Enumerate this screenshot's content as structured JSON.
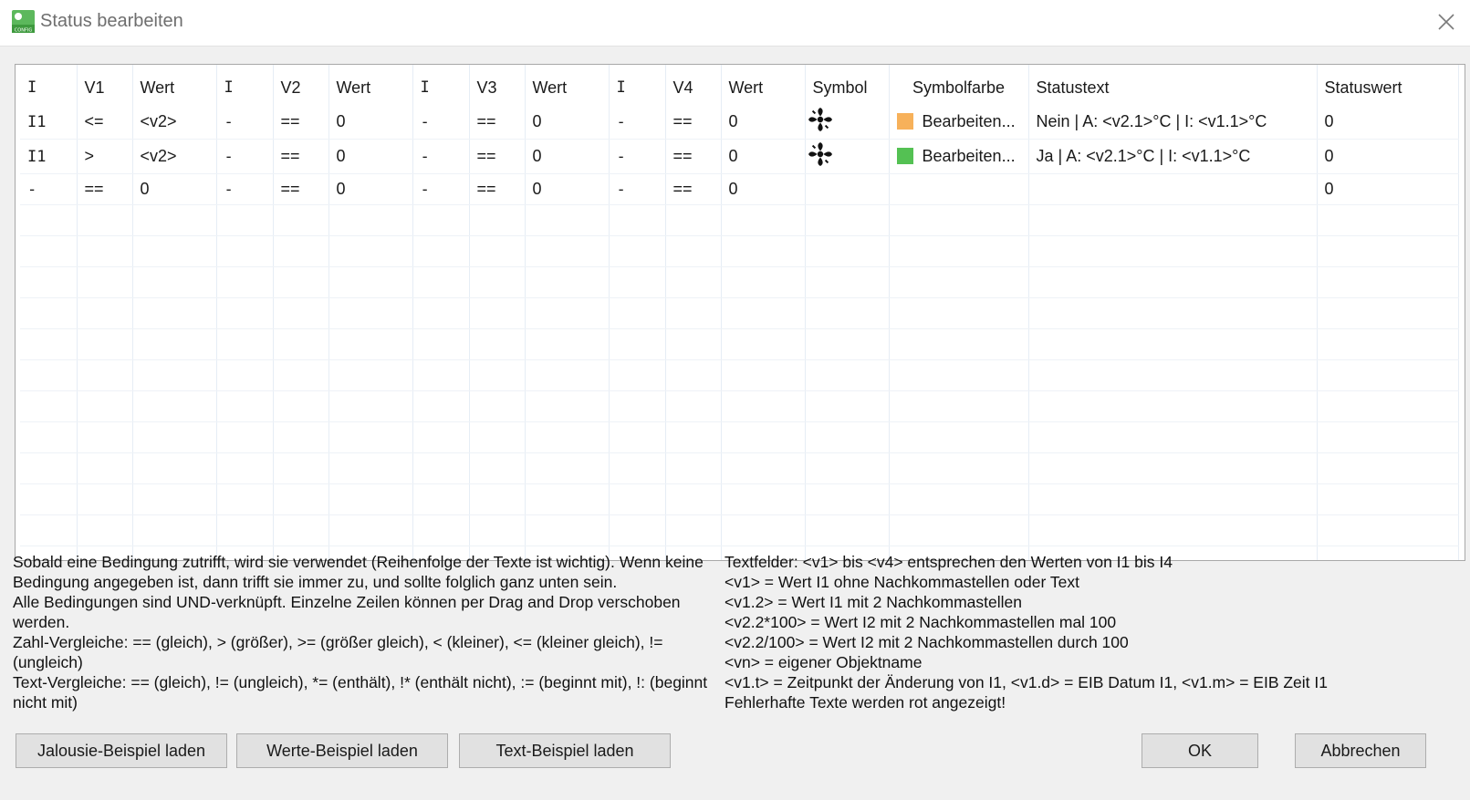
{
  "window": {
    "title": "Status bearbeiten"
  },
  "colors": {
    "orange": "#f7b15a",
    "green": "#54c153",
    "accent": "#4caf50"
  },
  "table": {
    "headers": [
      "I",
      "V1",
      "Wert",
      "I",
      "V2",
      "Wert",
      "I",
      "V3",
      "Wert",
      "I",
      "V4",
      "Wert",
      "Symbol",
      "Symbolfarbe",
      "Statustext",
      "Statuswert"
    ],
    "rows": [
      {
        "i1": "I1",
        "v1": "<=",
        "w1": "<v2>",
        "i2": "-",
        "v2": "==",
        "w2": "0",
        "i3": "-",
        "v3": "==",
        "w3": "0",
        "i4": "-",
        "v4": "==",
        "w4": "0",
        "symbol": "fan-icon",
        "color_label": "Bearbeiten...",
        "color_hex": "#f7b15a",
        "statustext": "Nein | A: <v2.1>°C | I: <v1.1>°C",
        "statuswert": "0"
      },
      {
        "i1": "I1",
        "v1": ">",
        "w1": "<v2>",
        "i2": "-",
        "v2": "==",
        "w2": "0",
        "i3": "-",
        "v3": "==",
        "w3": "0",
        "i4": "-",
        "v4": "==",
        "w4": "0",
        "symbol": "fan-icon",
        "color_label": "Bearbeiten...",
        "color_hex": "#54c153",
        "statustext": "Ja | A: <v2.1>°C | I: <v1.1>°C",
        "statuswert": "0"
      },
      {
        "i1": "-",
        "v1": "==",
        "w1": "0",
        "i2": "-",
        "v2": "==",
        "w2": "0",
        "i3": "-",
        "v3": "==",
        "w3": "0",
        "i4": "-",
        "v4": "==",
        "w4": "0",
        "symbol": "",
        "color_label": "",
        "color_hex": "",
        "statustext": "",
        "statuswert": "0"
      }
    ]
  },
  "help_left": [
    "Sobald eine Bedingung zutrifft, wird sie verwendet (Reihenfolge der Texte ist wichtig). Wenn keine Bedingung angegeben ist, dann trifft sie immer zu, und sollte folglich ganz unten sein.",
    "Alle Bedingungen sind UND-verknüpft. Einzelne Zeilen können per Drag and Drop verschoben werden.",
    "Zahl-Vergleiche: == (gleich), > (größer), >= (größer gleich), < (kleiner), <= (kleiner gleich), != (ungleich)",
    "Text-Vergleiche: == (gleich), != (ungleich), *= (enthält), !* (enthält nicht), := (beginnt mit), !: (beginnt nicht mit)"
  ],
  "help_right": [
    "Textfelder: <v1> bis <v4> entsprechen den Werten von I1 bis I4",
    "<v1> = Wert I1 ohne Nachkommastellen oder Text",
    "<v1.2> = Wert I1 mit 2 Nachkommastellen",
    "<v2.2*100> = Wert I2 mit 2 Nachkommastellen mal 100",
    "<v2.2/100> = Wert I2 mit 2 Nachkommastellen durch 100",
    "<vn> = eigener Objektname",
    "<v1.t> = Zeitpunkt der Änderung von I1, <v1.d> = EIB Datum I1, <v1.m> = EIB Zeit I1",
    "Fehlerhafte Texte werden rot angezeigt!"
  ],
  "buttons": {
    "jalousie": "Jalousie-Beispiel laden",
    "werte": "Werte-Beispiel laden",
    "text": "Text-Beispiel laden",
    "ok": "OK",
    "cancel": "Abbrechen"
  }
}
